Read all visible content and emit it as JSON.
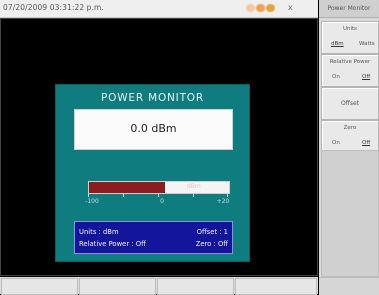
{
  "status_bar": {
    "datetime": "07/20/2009 03:31:22 p.m.",
    "close_glyph": "x",
    "indicator_colors": [
      "#f3c8a8",
      "#f0a24a",
      "#e7a33a"
    ]
  },
  "power_monitor": {
    "title": "POWER MONITOR",
    "reading": "0.0 dBm",
    "bar": {
      "fill_fraction": 0.54,
      "fill_color": "#8e1c1f",
      "center_mark": "dBm",
      "scale_labels": [
        "-100",
        "0",
        "+20"
      ]
    },
    "info": {
      "units_label": "Units : dBm",
      "offset_label": "Offset :",
      "offset_value": "1",
      "relative_label": "Relative Power : Off",
      "zero_label": "Zero :",
      "zero_value": "Off"
    },
    "colors": {
      "panel": "#0f7c80",
      "info_box": "#13169a"
    }
  },
  "softkeys": {
    "title": "Power Monitor",
    "units": {
      "label": "Units",
      "opt1": "dBm",
      "opt2": "Watts"
    },
    "relative_power": {
      "label": "Relative Power",
      "opt1": "On",
      "opt2": "Off"
    },
    "offset": {
      "label": "Offset"
    },
    "zero": {
      "label": "Zero",
      "opt1": "On",
      "opt2": "Off"
    }
  }
}
